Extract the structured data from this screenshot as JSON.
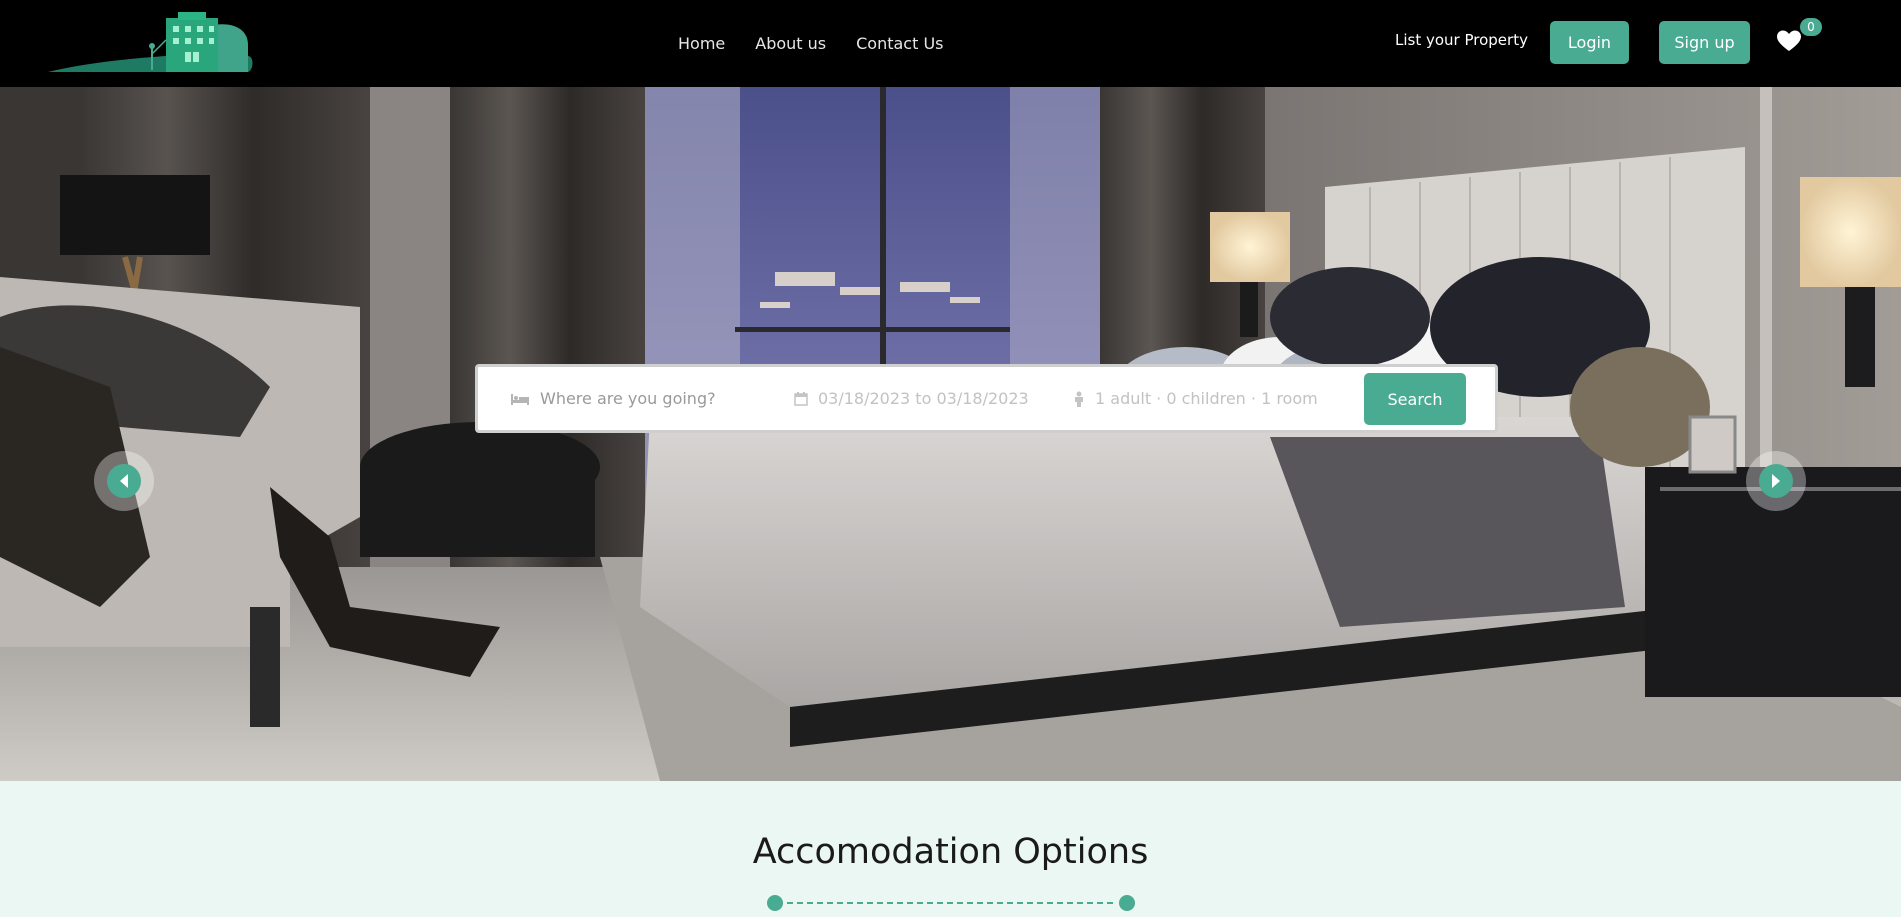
{
  "nav": {
    "links": [
      "Home",
      "About us",
      "Contact Us"
    ],
    "list_property": "List your Property",
    "login": "Login",
    "signup": "Sign up",
    "favorites_count": "0"
  },
  "search": {
    "destination_placeholder": "Where are you going?",
    "dates": "03/18/2023 to 03/18/2023",
    "guests": "1 adult · 0 children · 1 room",
    "button": "Search"
  },
  "section": {
    "title": "Accomodation Options"
  },
  "colors": {
    "accent": "#4aab93",
    "navbar": "#000000",
    "section_bg": "#eaf7f2"
  },
  "icons": {
    "prev": "chevron-left-icon",
    "next": "chevron-right-icon",
    "favorites": "heart-icon",
    "destination": "bed-icon",
    "dates": "calendar-icon",
    "guests": "person-icon"
  }
}
